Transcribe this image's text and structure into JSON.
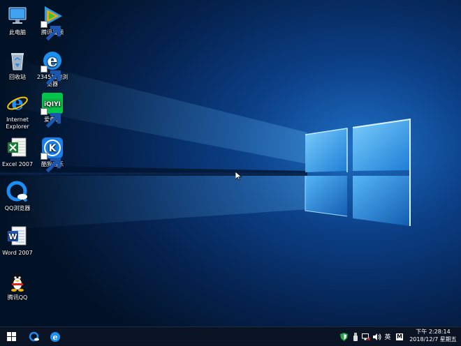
{
  "desktop": {
    "icons": [
      {
        "label": "此电脑",
        "icon": "this-pc-icon"
      },
      {
        "label": "腾讯视频",
        "icon": "tencent-video-icon"
      },
      {
        "label": "回收站",
        "icon": "recycle-bin-icon"
      },
      {
        "label": "2345加速浏览器",
        "icon": "2345-browser-icon"
      },
      {
        "label": "Internet Explorer",
        "icon": "ie-icon"
      },
      {
        "label": "爱奇艺",
        "icon": "iqiyi-icon"
      },
      {
        "label": "Excel 2007",
        "icon": "excel-icon"
      },
      {
        "label": "酷狗音乐",
        "icon": "kugou-icon"
      },
      {
        "label": "QQ浏览器",
        "icon": "qq-browser-icon"
      },
      {
        "label": "Word 2007",
        "icon": "word-icon"
      },
      {
        "label": "腾讯QQ",
        "icon": "qq-penguin-icon"
      }
    ],
    "iqiyi_text": "iQIYI",
    "kugou_letter": "K"
  },
  "taskbar": {
    "tray": {
      "input_lang": "英",
      "ime_label": "M"
    },
    "clock": {
      "time": "下午 2:28:14",
      "date": "2018/12/7 星期五"
    }
  },
  "colors": {
    "taskbar": "#0a1424",
    "wallpaper_glow": "#3fb0ff",
    "accent": "#0078d7"
  }
}
